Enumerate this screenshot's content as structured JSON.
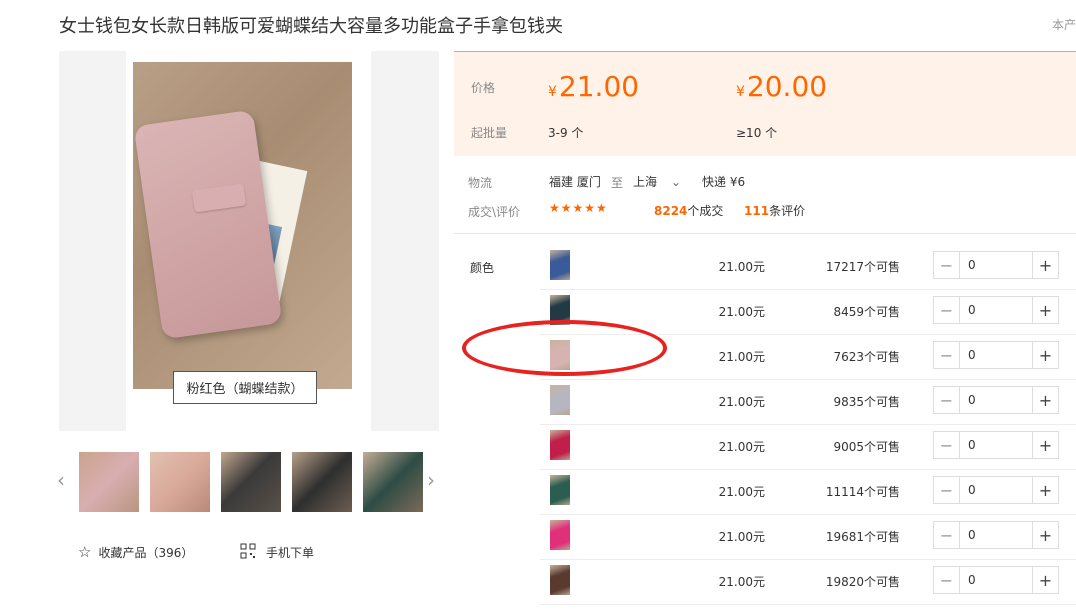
{
  "title": "女士钱包女长款日韩版可爱蝴蝶结大容量多功能盒子手拿包钱夹",
  "top_right": "本产",
  "gallery": {
    "caption": "粉红色（蝴蝶结款）",
    "thumbs": [
      {
        "color": "#d8aeb0"
      },
      {
        "color": "#d9a99a"
      },
      {
        "color": "#3a3a3a"
      },
      {
        "color": "#2f2f2f"
      },
      {
        "color": "#2d4c45"
      }
    ]
  },
  "actions": {
    "favorite_label": "收藏产品（396）",
    "mobile_label": "手机下单"
  },
  "price": {
    "price_label": "价格",
    "currency": "¥",
    "tier1_price": "21.00",
    "tier2_price": "20.00",
    "moq_label": "起批量",
    "tier1_qty": "3-9 个",
    "tier2_qty": "≥10 个"
  },
  "logistics": {
    "label": "物流",
    "from": "福建 厦门",
    "to_word": "至",
    "to": "上海",
    "shipping": "快递 ¥6"
  },
  "deals": {
    "label": "成交\\评价",
    "stars": "★★★★★",
    "deal_count": "8224",
    "deal_suffix": "个成交",
    "review_count": "111",
    "review_suffix": "条评价"
  },
  "sku": {
    "label": "颜色",
    "rows": [
      {
        "swatch": "#3b5a9a",
        "price": "21.00元",
        "stock": "17217个可售",
        "qty": "0"
      },
      {
        "swatch": "#223a44",
        "price": "21.00元",
        "stock": "8459个可售",
        "qty": "0"
      },
      {
        "swatch": "#d6b3b0",
        "price": "21.00元",
        "stock": "7623个可售",
        "qty": "0"
      },
      {
        "swatch": "#b6b6c0",
        "price": "21.00元",
        "stock": "9835个可售",
        "qty": "0"
      },
      {
        "swatch": "#c21e4a",
        "price": "21.00元",
        "stock": "9005个可售",
        "qty": "0"
      },
      {
        "swatch": "#2b5e50",
        "price": "21.00元",
        "stock": "11114个可售",
        "qty": "0"
      },
      {
        "swatch": "#e0307a",
        "price": "21.00元",
        "stock": "19681个可售",
        "qty": "0"
      },
      {
        "swatch": "#5a3a2e",
        "price": "21.00元",
        "stock": "19820个可售",
        "qty": "0"
      }
    ]
  },
  "accent_color": "#ff6600",
  "annotation_color": "#e8221f"
}
